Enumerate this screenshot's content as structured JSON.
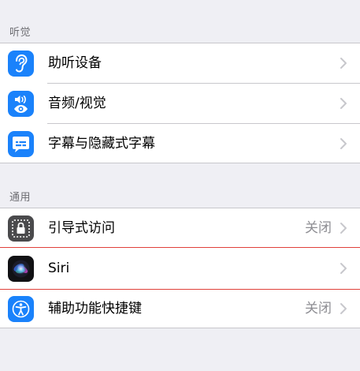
{
  "sections": [
    {
      "header": "听觉",
      "rows": [
        {
          "label": "助听设备",
          "value": "",
          "icon": "ear-icon"
        },
        {
          "label": "音频/视觉",
          "value": "",
          "icon": "audio-visual-icon"
        },
        {
          "label": "字幕与隐藏式字幕",
          "value": "",
          "icon": "captions-icon"
        }
      ]
    },
    {
      "header": "通用",
      "rows": [
        {
          "label": "引导式访问",
          "value": "关闭",
          "icon": "guided-access-lock-icon"
        },
        {
          "label": "Siri",
          "value": "",
          "icon": "siri-icon"
        },
        {
          "label": "辅助功能快捷键",
          "value": "关闭",
          "icon": "accessibility-icon"
        }
      ]
    }
  ],
  "colors": {
    "background": "#efeff4",
    "icon_blue": "#1a82fb",
    "icon_gray": "#4a4a4c",
    "highlight_red": "#e0413a",
    "secondary_text": "#8e8e93"
  }
}
